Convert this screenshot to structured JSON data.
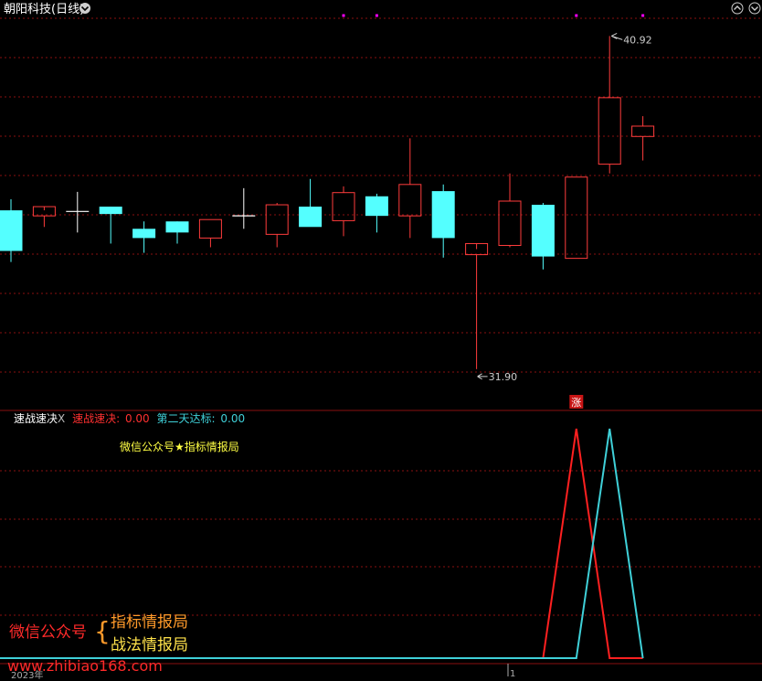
{
  "header": {
    "title": "朝阳科技",
    "period": "(日线)"
  },
  "indicator": {
    "name": "速战速决",
    "close_mark": "X",
    "line1_label": "速战速决:",
    "line1_value": "0.00",
    "line2_label": "第二天达标:",
    "line2_value": "0.00",
    "watermark": "微信公众号★指标情报局"
  },
  "branding": {
    "wechat": "微信公众号",
    "brace": "{",
    "line1": "指标情报局",
    "line2": "战法情报局",
    "url": "www.zhibiao168.com"
  },
  "time_axis": {
    "year_label": "2023年",
    "month_label": "1"
  },
  "colors": {
    "up": "#ff3c3c",
    "down": "#54ffff",
    "doji": "#ffffff",
    "grid": "#8a1010",
    "line1": "#ff2020",
    "line2": "#3fd0d8",
    "marker": "#ff00ff",
    "title": "#ffffff",
    "watermark": "#ffff44",
    "brand_red": "#ff2a2a",
    "brand_orange": "#ff9a2a",
    "brand_yellow": "#ffe24a"
  },
  "chart_data": [
    {
      "type": "candlestick",
      "ylim": [
        31.5,
        41.4
      ],
      "max_label": "40.92",
      "min_label": "31.90",
      "zhang_label": "涨",
      "zhang_index": 17,
      "marker_indices": [
        10,
        11,
        17,
        19
      ],
      "candles": [
        {
          "o": 36.2,
          "h": 36.5,
          "l": 34.8,
          "c": 35.1
        },
        {
          "o": 36.05,
          "h": 36.2,
          "l": 35.75,
          "c": 36.3
        },
        {
          "o": 36.17,
          "h": 36.7,
          "l": 35.6,
          "c": 36.17
        },
        {
          "o": 36.3,
          "h": 36.3,
          "l": 35.3,
          "c": 36.1
        },
        {
          "o": 35.7,
          "h": 35.9,
          "l": 35.05,
          "c": 35.45
        },
        {
          "o": 35.9,
          "h": 35.9,
          "l": 35.3,
          "c": 35.6
        },
        {
          "o": 35.45,
          "h": 35.95,
          "l": 35.2,
          "c": 35.95
        },
        {
          "o": 36.05,
          "h": 36.8,
          "l": 35.7,
          "c": 36.05
        },
        {
          "o": 35.55,
          "h": 36.4,
          "l": 35.2,
          "c": 36.35
        },
        {
          "o": 36.3,
          "h": 37.05,
          "l": 35.8,
          "c": 35.75
        },
        {
          "o": 35.92,
          "h": 36.85,
          "l": 35.5,
          "c": 36.68
        },
        {
          "o": 36.58,
          "h": 36.65,
          "l": 35.6,
          "c": 36.05
        },
        {
          "o": 36.05,
          "h": 38.15,
          "l": 35.45,
          "c": 36.9
        },
        {
          "o": 36.72,
          "h": 36.9,
          "l": 34.92,
          "c": 35.45
        },
        {
          "o": 35.0,
          "h": 35.15,
          "l": 31.9,
          "c": 35.3
        },
        {
          "o": 35.25,
          "h": 37.2,
          "l": 35.2,
          "c": 36.45
        },
        {
          "o": 36.35,
          "h": 36.4,
          "l": 34.6,
          "c": 34.95
        },
        {
          "o": 34.9,
          "h": 37.1,
          "l": 34.9,
          "c": 37.1
        },
        {
          "o": 37.45,
          "h": 40.92,
          "l": 37.2,
          "c": 39.25
        },
        {
          "o": 38.2,
          "h": 38.75,
          "l": 37.55,
          "c": 38.48
        }
      ]
    },
    {
      "type": "line",
      "ylim": [
        0,
        1
      ],
      "series": [
        {
          "name": "速战速决",
          "x": [
            0,
            16,
            17,
            18,
            19
          ],
          "values": [
            0,
            0,
            1,
            0,
            0
          ]
        },
        {
          "name": "第二天达标",
          "x": [
            0,
            17,
            18,
            19
          ],
          "values": [
            0,
            0,
            1,
            0
          ]
        }
      ]
    }
  ]
}
